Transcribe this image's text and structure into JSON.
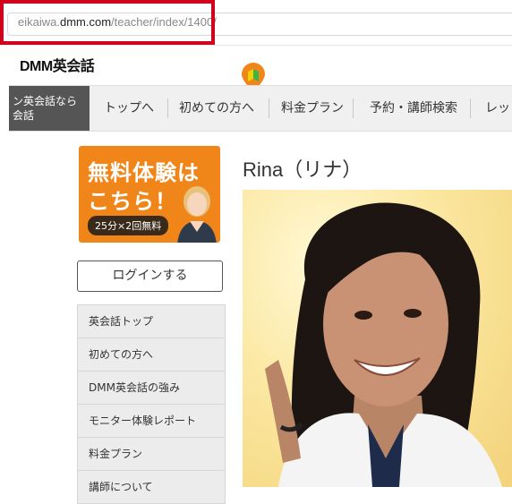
{
  "browser": {
    "url_prefix": "eikaiwa.",
    "url_domain": "dmm.com",
    "url_path": "/teacher/index/1400/"
  },
  "header": {
    "logo_text": "DMM英会話"
  },
  "nav": {
    "brand_line1": "ン英会話なら",
    "brand_line2": "会話",
    "items": [
      {
        "label": "トップへ"
      },
      {
        "label": "初めての方へ"
      },
      {
        "label": "料金プラン"
      },
      {
        "label": "予約・講師検索"
      },
      {
        "label": "レッ"
      }
    ]
  },
  "promo": {
    "line1": "無料体験は",
    "line2": "こちら！",
    "pill": "25分×2回無料"
  },
  "sidebar": {
    "login_label": "ログインする",
    "menu": [
      {
        "label": "英会話トップ"
      },
      {
        "label": "初めての方へ"
      },
      {
        "label": "DMM英会話の強み"
      },
      {
        "label": "モニター体験レポート"
      },
      {
        "label": "料金プラン"
      },
      {
        "label": "講師について"
      }
    ]
  },
  "teacher": {
    "name": "Rina（リナ）"
  },
  "colors": {
    "highlight_box": "#d0021b",
    "promo_orange": "#f08519",
    "nav_bg": "#f0f0f0",
    "badge_orange": "#f08519",
    "badge_leaf_green": "#3cb44b",
    "badge_leaf_yellow": "#f5d000"
  }
}
